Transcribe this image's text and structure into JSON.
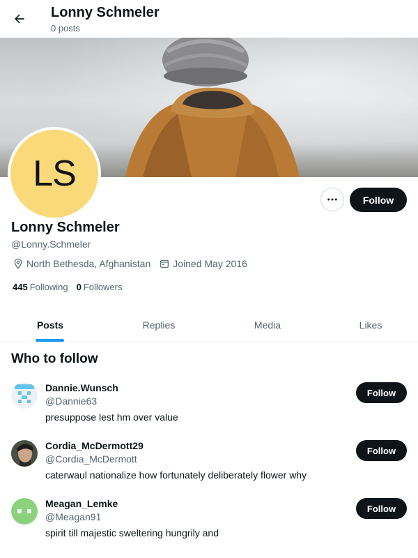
{
  "header": {
    "title": "Lonny Schmeler",
    "subtitle": "0 posts"
  },
  "profile": {
    "initials": "LS",
    "name": "Lonny Schmeler",
    "handle": "@Lonny.Schmeler",
    "location": "North Bethesda, Afghanistan",
    "joined": "Joined May 2016",
    "following_count": "445",
    "following_label": "Following",
    "followers_count": "0",
    "followers_label": "Followers",
    "follow_label": "Follow",
    "avatar_color": "#fad97a"
  },
  "tabs": [
    {
      "label": "Posts",
      "active": true
    },
    {
      "label": "Replies",
      "active": false
    },
    {
      "label": "Media",
      "active": false
    },
    {
      "label": "Likes",
      "active": false
    }
  ],
  "who_to_follow": {
    "title": "Who to follow",
    "items": [
      {
        "name": "Dannie.Wunsch",
        "handle": "@Dannie63",
        "bio": "presuppose lest hm over value",
        "follow_label": "Follow"
      },
      {
        "name": "Cordia_McDermott29",
        "handle": "@Cordia_McDermott",
        "bio": "caterwaul nationalize how fortunately deliberately flower why",
        "follow_label": "Follow"
      },
      {
        "name": "Meagan_Lemke",
        "handle": "@Meagan91",
        "bio": "spirit till majestic sweltering hungrily and",
        "follow_label": "Follow"
      }
    ]
  },
  "colors": {
    "accent": "#1d9bf0",
    "button": "#0f1419",
    "muted": "#536471"
  }
}
